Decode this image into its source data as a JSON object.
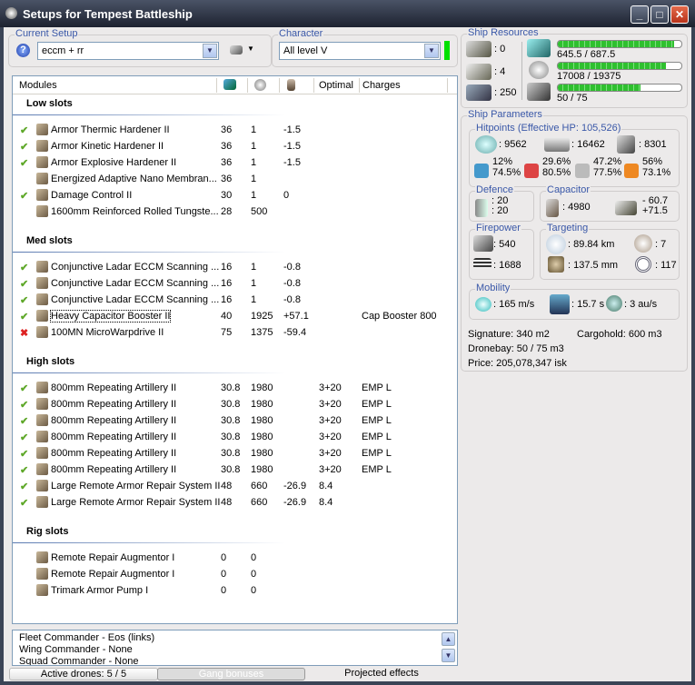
{
  "window": {
    "title": "Setups for Tempest Battleship"
  },
  "setup": {
    "label": "Current Setup",
    "value": "eccm + rr"
  },
  "character": {
    "label": "Character",
    "value": "All level V",
    "status_color": "#00e000"
  },
  "modules": {
    "headers": {
      "name": "Modules",
      "cpu_icon": "cpu-icon",
      "pg_icon": "powergrid-icon",
      "cap_icon": "capacitor-icon",
      "optimal": "Optimal",
      "charges": "Charges"
    },
    "sections": [
      {
        "title": "Low slots",
        "rows": [
          {
            "status": "on",
            "name": "Armor Thermic Hardener II",
            "cpu": "36",
            "pg": "1",
            "cap": "-1.5",
            "optimal": "",
            "charges": ""
          },
          {
            "status": "on",
            "name": "Armor Kinetic Hardener II",
            "cpu": "36",
            "pg": "1",
            "cap": "-1.5",
            "optimal": "",
            "charges": ""
          },
          {
            "status": "on",
            "name": "Armor Explosive Hardener II",
            "cpu": "36",
            "pg": "1",
            "cap": "-1.5",
            "optimal": "",
            "charges": ""
          },
          {
            "status": "",
            "name": "Energized Adaptive Nano Membran...",
            "cpu": "36",
            "pg": "1",
            "cap": "",
            "optimal": "",
            "charges": ""
          },
          {
            "status": "on",
            "name": "Damage Control II",
            "cpu": "30",
            "pg": "1",
            "cap": "0",
            "optimal": "",
            "charges": ""
          },
          {
            "status": "",
            "name": "1600mm Reinforced Rolled Tungste...",
            "cpu": "28",
            "pg": "500",
            "cap": "",
            "optimal": "",
            "charges": ""
          }
        ]
      },
      {
        "title": "Med slots",
        "rows": [
          {
            "status": "on",
            "name": "Conjunctive Ladar ECCM Scanning ...",
            "cpu": "16",
            "pg": "1",
            "cap": "-0.8",
            "optimal": "",
            "charges": ""
          },
          {
            "status": "on",
            "name": "Conjunctive Ladar ECCM Scanning ...",
            "cpu": "16",
            "pg": "1",
            "cap": "-0.8",
            "optimal": "",
            "charges": ""
          },
          {
            "status": "on",
            "name": "Conjunctive Ladar ECCM Scanning ...",
            "cpu": "16",
            "pg": "1",
            "cap": "-0.8",
            "optimal": "",
            "charges": ""
          },
          {
            "status": "on",
            "name": "Heavy Capacitor Booster II",
            "cpu": "40",
            "pg": "1925",
            "cap": "+57.1",
            "optimal": "",
            "charges": "Cap Booster 800",
            "selected": true
          },
          {
            "status": "off",
            "name": "100MN MicroWarpdrive II",
            "cpu": "75",
            "pg": "1375",
            "cap": "-59.4",
            "optimal": "",
            "charges": ""
          }
        ]
      },
      {
        "title": "High slots",
        "rows": [
          {
            "status": "on",
            "name": "800mm Repeating Artillery II",
            "cpu": "30.8",
            "pg": "1980",
            "cap": "",
            "optimal": "3+20",
            "charges": "EMP L"
          },
          {
            "status": "on",
            "name": "800mm Repeating Artillery II",
            "cpu": "30.8",
            "pg": "1980",
            "cap": "",
            "optimal": "3+20",
            "charges": "EMP L"
          },
          {
            "status": "on",
            "name": "800mm Repeating Artillery II",
            "cpu": "30.8",
            "pg": "1980",
            "cap": "",
            "optimal": "3+20",
            "charges": "EMP L"
          },
          {
            "status": "on",
            "name": "800mm Repeating Artillery II",
            "cpu": "30.8",
            "pg": "1980",
            "cap": "",
            "optimal": "3+20",
            "charges": "EMP L"
          },
          {
            "status": "on",
            "name": "800mm Repeating Artillery II",
            "cpu": "30.8",
            "pg": "1980",
            "cap": "",
            "optimal": "3+20",
            "charges": "EMP L"
          },
          {
            "status": "on",
            "name": "800mm Repeating Artillery II",
            "cpu": "30.8",
            "pg": "1980",
            "cap": "",
            "optimal": "3+20",
            "charges": "EMP L"
          },
          {
            "status": "on",
            "name": "Large Remote Armor Repair System II",
            "cpu": "48",
            "pg": "660",
            "cap": "-26.9",
            "optimal": "8.4",
            "charges": ""
          },
          {
            "status": "on",
            "name": "Large Remote Armor Repair System II",
            "cpu": "48",
            "pg": "660",
            "cap": "-26.9",
            "optimal": "8.4",
            "charges": ""
          }
        ]
      },
      {
        "title": "Rig slots",
        "rows": [
          {
            "status": "",
            "name": "Remote Repair Augmentor I",
            "cpu": "0",
            "pg": "0",
            "cap": "",
            "optimal": "",
            "charges": ""
          },
          {
            "status": "",
            "name": "Remote Repair Augmentor I",
            "cpu": "0",
            "pg": "0",
            "cap": "",
            "optimal": "",
            "charges": ""
          },
          {
            "status": "",
            "name": "Trimark Armor Pump I",
            "cpu": "0",
            "pg": "0",
            "cap": "",
            "optimal": "",
            "charges": ""
          }
        ]
      }
    ]
  },
  "gang": {
    "lines": [
      "Fleet Commander - Eos (links)",
      "Wing Commander - None",
      "Squad Commander - None"
    ]
  },
  "tabs": {
    "drones": "Active drones: 5 / 5",
    "gang": "Gang bonuses",
    "projected": "Projected effects"
  },
  "resources": {
    "label": "Ship Resources",
    "turrets": ": 0",
    "launchers": ": 4",
    "calibration": ": 250",
    "cpu": {
      "text": "645.5 / 687.5",
      "fraction": 0.939
    },
    "powergrid": {
      "text": "17008 / 19375",
      "fraction": 0.878
    },
    "drone_bw": {
      "text": "50 / 75",
      "fraction": 0.667
    }
  },
  "parameters": {
    "label": "Ship Parameters",
    "hitpoints": {
      "label": "Hitpoints (Effective HP: 105,526)",
      "shield": ": 9562",
      "armor": ": 16462",
      "structure": ": 8301",
      "resists": [
        {
          "top": "12%",
          "bottom": "74.5%"
        },
        {
          "top": "29.6%",
          "bottom": "80.5%"
        },
        {
          "top": "47.2%",
          "bottom": "77.5%"
        },
        {
          "top": "56%",
          "bottom": "73.1%"
        }
      ]
    },
    "defence": {
      "label": "Defence",
      "a": ": 20",
      "b": ": 20"
    },
    "capacitor": {
      "label": "Capacitor",
      "amount": ": 4980",
      "use": "- 60.7",
      "gain": "+71.5"
    },
    "firepower": {
      "label": "Firepower",
      "dps": ": 540",
      "volley": ": 1688"
    },
    "targeting": {
      "label": "Targeting",
      "range": ": 89.84 km",
      "targets": ": 7",
      "sensor": ": 137.5 mm",
      "scan_res": ": 117"
    },
    "mobility": {
      "label": "Mobility",
      "speed": ": 165 m/s",
      "align": ": 15.7 s",
      "warp": ": 3 au/s"
    },
    "signature": "Signature: 340 m2",
    "cargohold": "Cargohold: 600 m3",
    "dronebay": "Dronebay: 50 / 75 m3",
    "price": "Price: 205,078,347 isk"
  }
}
